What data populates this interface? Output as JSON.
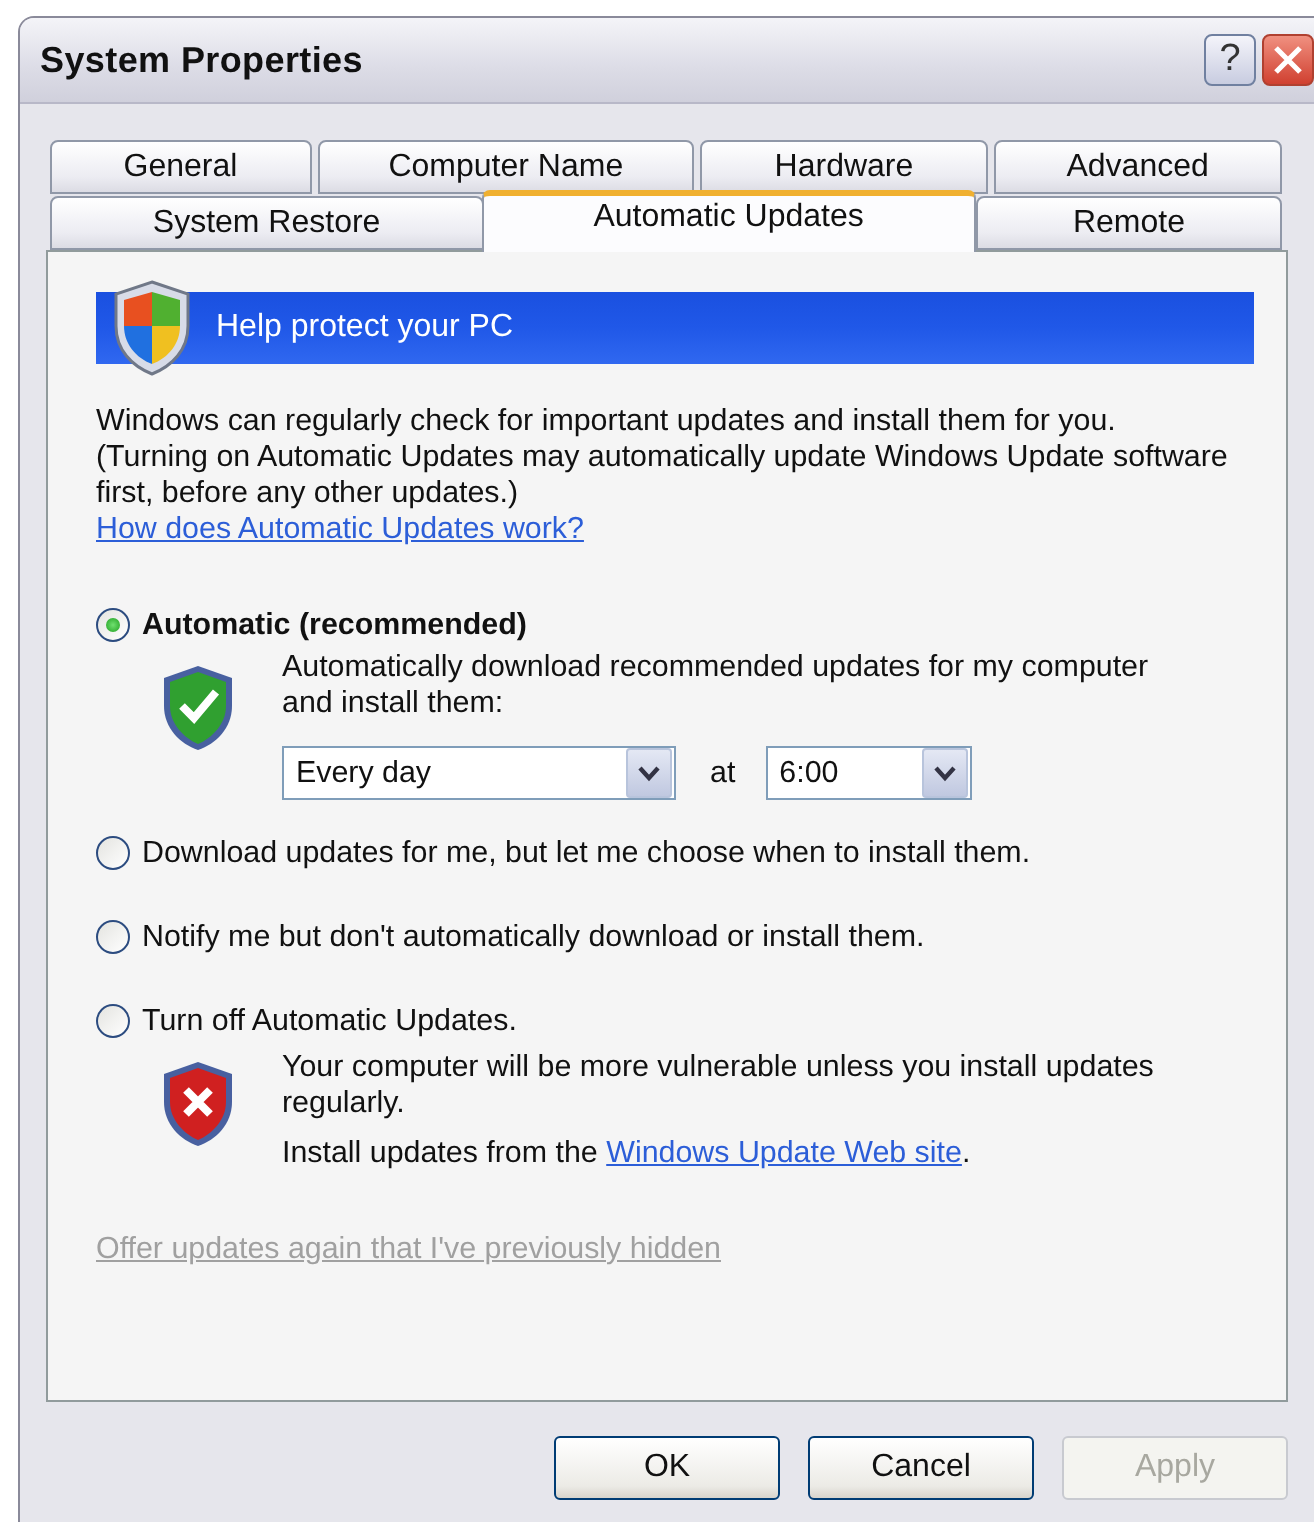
{
  "window": {
    "title": "System Properties",
    "help_button": "?"
  },
  "tab_rows": [
    {
      "tabs": [
        {
          "label": "General",
          "selected": false
        },
        {
          "label": "Computer Name",
          "selected": false
        },
        {
          "label": "Hardware",
          "selected": false
        },
        {
          "label": "Advanced",
          "selected": false
        }
      ]
    },
    {
      "tabs": [
        {
          "label": "System Restore",
          "selected": false
        },
        {
          "label": "Automatic Updates",
          "selected": true
        },
        {
          "label": "Remote",
          "selected": false
        }
      ]
    }
  ],
  "banner": {
    "title": "Help protect your PC"
  },
  "intro": {
    "sentences": [
      "Windows can regularly check for important updates and install them for you.",
      "(Turning on Automatic Updates may automatically update Windows Update software first, before any other updates.)"
    ],
    "link": "How does Automatic Updates work?"
  },
  "options": [
    {
      "kind": "schedule",
      "label": "Automatic (recommended)",
      "selected": true,
      "description": "Automatically download recommended updates for my computer and install them:",
      "frequency": "Every day",
      "at_label": "at",
      "time": "6:00"
    },
    {
      "kind": "plain",
      "label": "Download updates for me, but let me choose when to install them.",
      "selected": false
    },
    {
      "kind": "plain",
      "label": "Notify me but don't automatically download or install them.",
      "selected": false
    },
    {
      "kind": "warning",
      "label": "Turn off Automatic Updates.",
      "selected": false,
      "description": "Your computer will be more vulnerable unless you install updates regularly.",
      "install_text": "Install updates from the",
      "install_link": "Windows Update Web site",
      "install_suffix": "."
    }
  ],
  "hidden_link": {
    "label": "Offer updates again that I've previously hidden",
    "disabled": true
  },
  "buttons": [
    {
      "label": "OK",
      "disabled": false
    },
    {
      "label": "Cancel",
      "disabled": false
    },
    {
      "label": "Apply",
      "disabled": true
    }
  ]
}
